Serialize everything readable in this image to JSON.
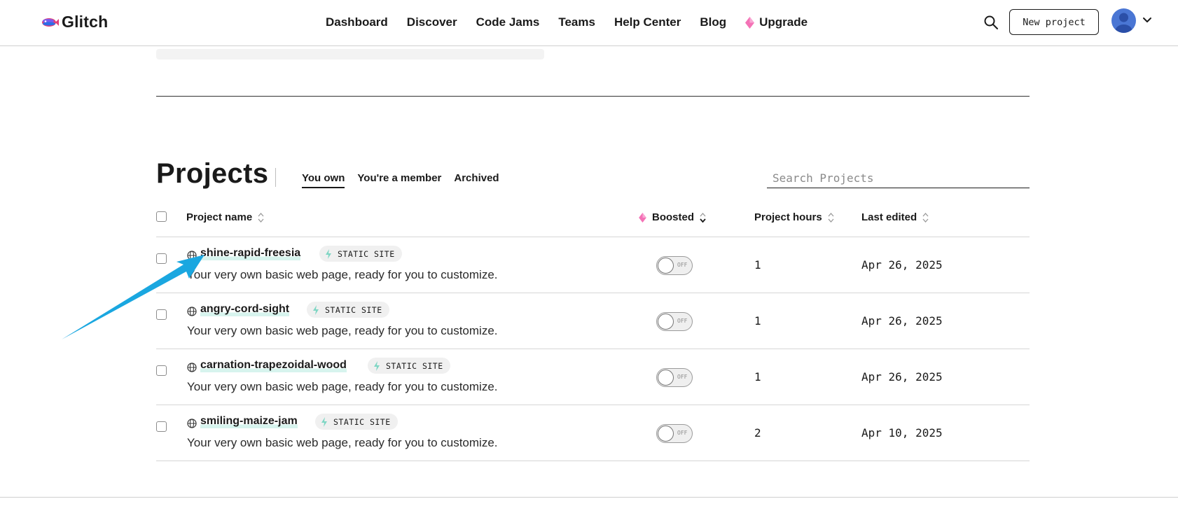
{
  "header": {
    "logo_text": "Glitch",
    "nav": [
      "Dashboard",
      "Discover",
      "Code Jams",
      "Teams",
      "Help Center",
      "Blog"
    ],
    "upgrade_label": "Upgrade",
    "new_project_label": "New project"
  },
  "projects": {
    "title": "Projects",
    "tabs": [
      {
        "label": "You own",
        "active": true
      },
      {
        "label": "You're a member",
        "active": false
      },
      {
        "label": "Archived",
        "active": false
      }
    ],
    "search_placeholder": "Search Projects",
    "columns": {
      "name": "Project name",
      "boosted": "Boosted",
      "hours": "Project hours",
      "edited": "Last edited"
    },
    "rows": [
      {
        "name": "shine-rapid-freesia",
        "badge": "STATIC SITE",
        "description": "Your very own basic web page, ready for you to customize.",
        "boost": "OFF",
        "hours": "1",
        "edited": "Apr 26, 2025"
      },
      {
        "name": "angry-cord-sight",
        "badge": "STATIC SITE",
        "description": "Your very own basic web page, ready for you to customize.",
        "boost": "OFF",
        "hours": "1",
        "edited": "Apr 26, 2025"
      },
      {
        "name": "carnation-trapezoidal-wood",
        "badge": "STATIC SITE",
        "description": "Your very own basic web page, ready for you to customize.",
        "boost": "OFF",
        "hours": "1",
        "edited": "Apr 26, 2025"
      },
      {
        "name": "smiling-maize-jam",
        "badge": "STATIC SITE",
        "description": "Your very own basic web page, ready for you to customize.",
        "boost": "OFF",
        "hours": "2",
        "edited": "Apr 10, 2025"
      }
    ]
  },
  "colors": {
    "accent_highlight": "#d7f4ee",
    "annotation_arrow": "#1aa7e0",
    "gem": "#f472b6",
    "avatar": "#4a76d4"
  },
  "icons": [
    "glitch-logo-icon",
    "search-icon",
    "avatar-icon",
    "chevron-down-icon",
    "gem-icon",
    "sort-icon",
    "globe-icon",
    "bolt-icon"
  ]
}
